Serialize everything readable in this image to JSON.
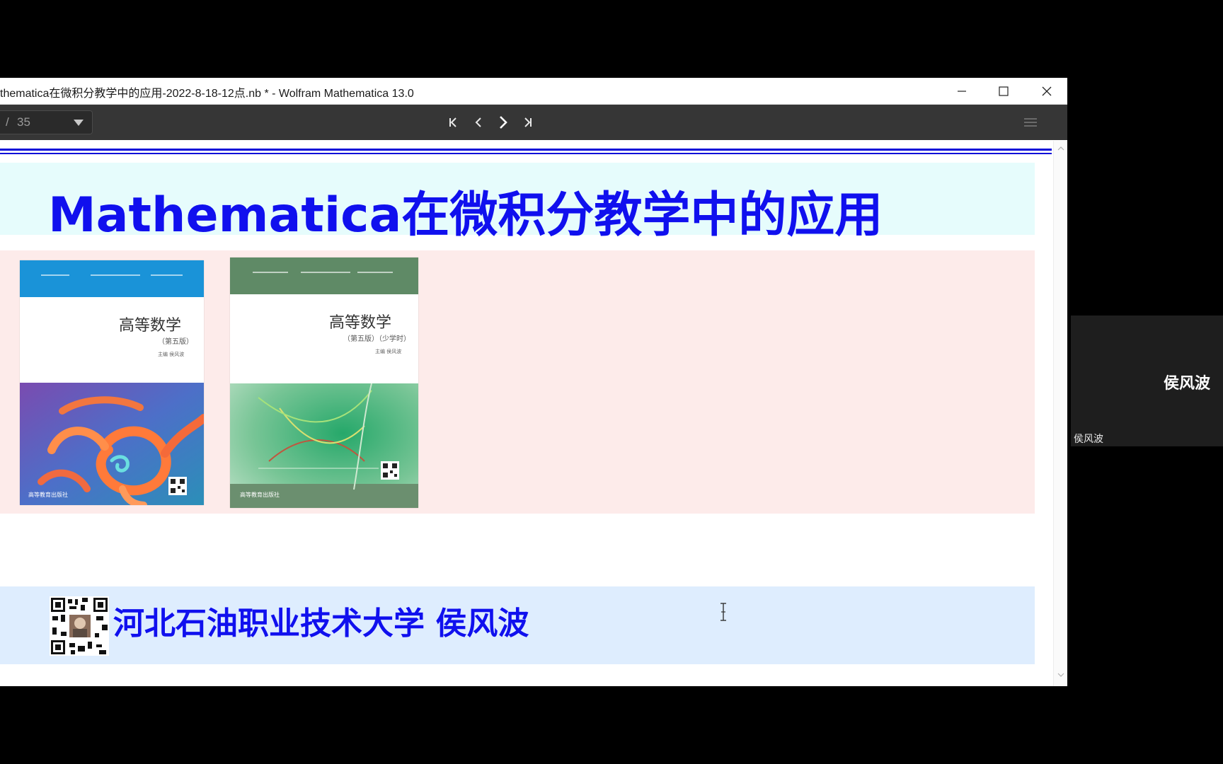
{
  "window": {
    "title": "thematica在微积分教学中的应用-2022-8-18-12点.nb * - Wolfram Mathematica 13.0"
  },
  "icons": {
    "minimize": "minimize-icon",
    "maximize": "maximize-icon",
    "close": "close-icon",
    "first": "first-slide-icon",
    "prev": "previous-slide-icon",
    "next": "next-slide-icon",
    "last": "last-slide-icon",
    "menu": "hamburger-menu-icon"
  },
  "toolbar": {
    "slash": "/",
    "total_pages": "35"
  },
  "slide": {
    "title": "Mathematica在微积分教学中的应用",
    "books": [
      {
        "title": "高等数学",
        "subtitle": "（第五版）",
        "author": "主编 侯风波",
        "publisher": "高等教育出版社",
        "band_color": "#1a93d8"
      },
      {
        "title": "高等数学",
        "subtitle": "（第五版）（少学时）",
        "author": "主编 侯风波",
        "publisher": "高等教育出版社",
        "band_color": "#5f8a66"
      }
    ],
    "footer": "河北石油职业技术大学 侯风波"
  },
  "participant": {
    "name_large": "侯风波",
    "name_small": "侯风波"
  },
  "colors": {
    "title_text": "#1010ee",
    "title_cell_bg": "#e6fcfc",
    "image_cell_bg": "#fdebea",
    "footer_cell_bg": "#deedfe",
    "rule": "#0a0ad8"
  }
}
